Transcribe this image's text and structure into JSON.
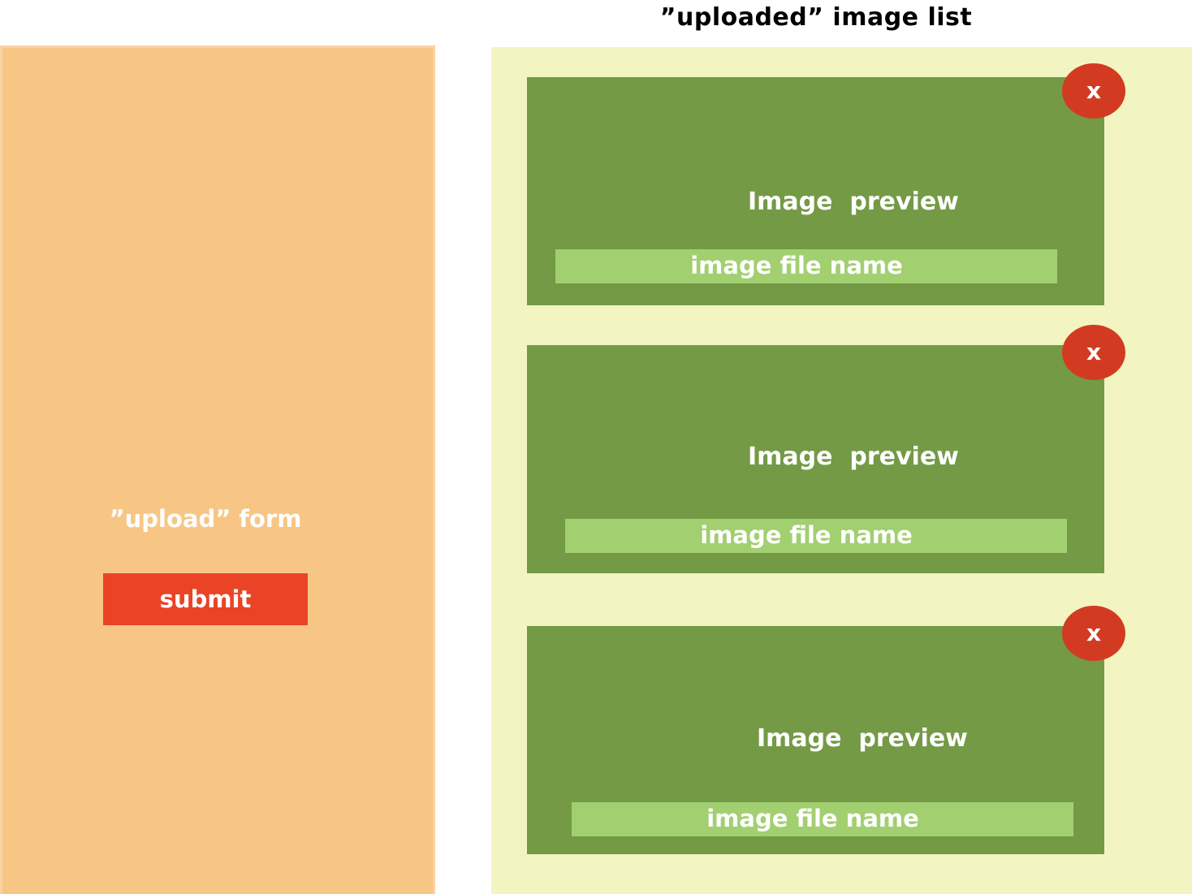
{
  "list_section": {
    "title": "”uploaded” image list"
  },
  "upload_form": {
    "label": "”upload” form",
    "submit_label": "submit"
  },
  "image_cards": [
    {
      "preview_label": "Image  preview",
      "filename": "image file name",
      "remove_label": "x"
    },
    {
      "preview_label": "Image  preview",
      "filename": "image file name",
      "remove_label": "x"
    },
    {
      "preview_label": "Image  preview",
      "filename": "image file name",
      "remove_label": "x"
    }
  ],
  "colors": {
    "upload_panel": "#f7c685",
    "submit_button": "#ea4326",
    "list_panel": "#f2f5c1",
    "card": "#749a46",
    "filename_bar": "#a2cf70",
    "remove_button": "#d23b22"
  }
}
